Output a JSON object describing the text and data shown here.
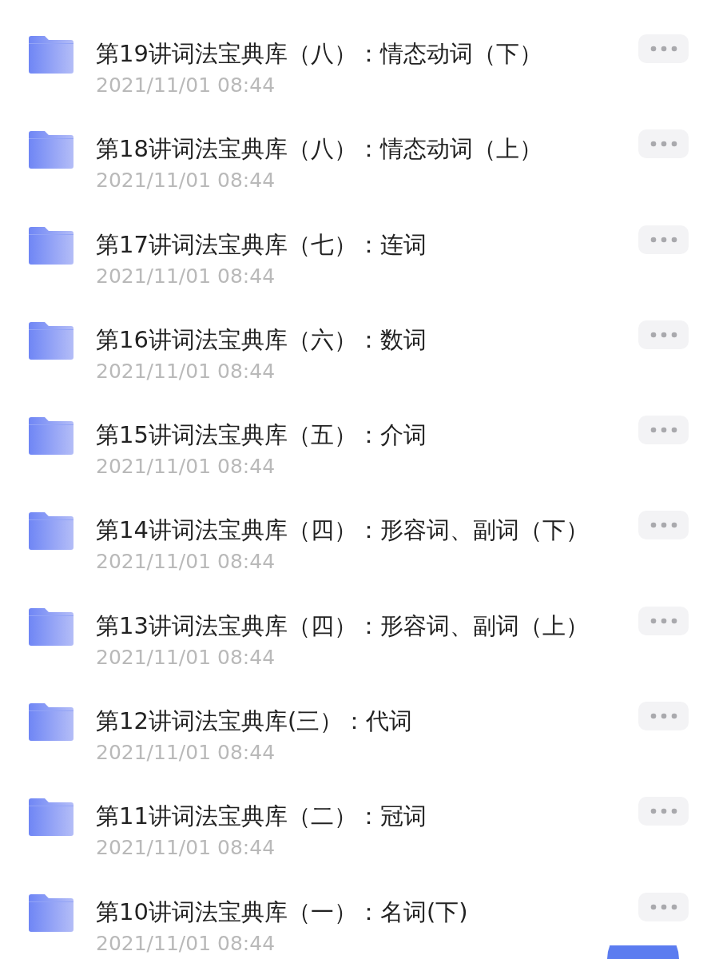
{
  "files": [
    {
      "name": "第19讲词法宝典库（八）：情态动词（下）",
      "date": "2021/11/01 08:44"
    },
    {
      "name": "第18讲词法宝典库（八）：情态动词（上）",
      "date": "2021/11/01 08:44"
    },
    {
      "name": "第17讲词法宝典库（七）：连词",
      "date": "2021/11/01 08:44"
    },
    {
      "name": "第16讲词法宝典库（六）：数词",
      "date": "2021/11/01 08:44"
    },
    {
      "name": "第15讲词法宝典库（五）：介词",
      "date": "2021/11/01 08:44"
    },
    {
      "name": "第14讲词法宝典库（四）：形容词、副词（下）",
      "date": "2021/11/01 08:44"
    },
    {
      "name": "第13讲词法宝典库（四）：形容词、副词（上）",
      "date": "2021/11/01 08:44"
    },
    {
      "name": "第12讲词法宝典库(三）：代词",
      "date": "2021/11/01 08:44"
    },
    {
      "name": "第11讲词法宝典库（二）：冠词",
      "date": "2021/11/01 08:44"
    },
    {
      "name": "第10讲词法宝典库（一）：名词(下)",
      "date": "2021/11/01 08:44"
    }
  ]
}
